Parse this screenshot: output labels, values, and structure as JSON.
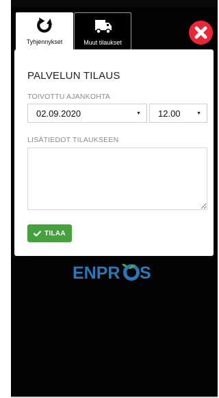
{
  "tabs": [
    {
      "label": "Tyhjennykset",
      "icon": "recycle-icon",
      "active": true
    },
    {
      "label": "Muut tilaukset",
      "icon": "truck-icon",
      "active": false
    }
  ],
  "close": {
    "icon": "close-icon",
    "color": "#e8273a"
  },
  "form": {
    "title": "PALVELUN TILAUS",
    "time_label": "TOIVOTTU AJANKOHTA",
    "date_value": "02.09.2020",
    "hour_value": "12.00",
    "info_label": "LISÄTIEDOT TILAUKSEEN",
    "info_value": "",
    "submit_label": "TILAA",
    "submit_icon": "check-icon",
    "submit_color": "#45a13b"
  },
  "brand": {
    "text": "ENPROS",
    "color": "#2a78b8",
    "accent": "#3fae49"
  }
}
